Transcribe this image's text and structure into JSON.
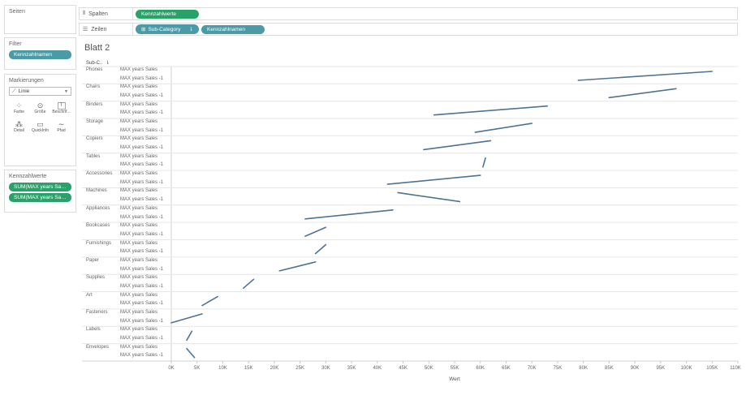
{
  "left_panel": {
    "pages_title": "Seiten",
    "filters_title": "Filter",
    "filter_pills": [
      "Kennzahlnamen"
    ],
    "marks_title": "Markierungen",
    "marks_type": "Linie",
    "marks_buttons": [
      {
        "label": "Farbe",
        "icon": "color-icon"
      },
      {
        "label": "Größe",
        "icon": "size-icon"
      },
      {
        "label": "Beschrif...",
        "icon": "label-icon"
      },
      {
        "label": "Detail",
        "icon": "detail-icon"
      },
      {
        "label": "QuickInfo",
        "icon": "tooltip-icon"
      },
      {
        "label": "Pfad",
        "icon": "path-icon"
      }
    ],
    "measure_values_title": "Kennzahlwerte",
    "measure_value_pills": [
      "SUM(MAX years Sales)",
      "SUM(MAX years Sales..."
    ]
  },
  "shelves": {
    "columns_label": "Spalten",
    "columns_pills": [
      "Kennzahlwerte"
    ],
    "rows_label": "Zeilen",
    "rows_pills": [
      "Sub-Category",
      "Kennzahlnamen"
    ]
  },
  "sheet": {
    "title": "Blatt 2",
    "row_header": "Sub-C..",
    "x_axis_title": "Wert",
    "measure_names": [
      "MAX years Sales",
      "MAX years Sales -1"
    ]
  },
  "colors": {
    "line": "#4e7394",
    "pill_blue": "#4a9aa8",
    "pill_green": "#27a36a",
    "gridline": "#e6e6e6"
  },
  "chart_data": {
    "type": "line",
    "x_axis": {
      "label": "Wert",
      "min": 0,
      "max": 110000,
      "ticks": [
        "0K",
        "5K",
        "10K",
        "15K",
        "20K",
        "25K",
        "30K",
        "35K",
        "40K",
        "45K",
        "50K",
        "55K",
        "60K",
        "65K",
        "70K",
        "75K",
        "80K",
        "85K",
        "90K",
        "95K",
        "100K",
        "105K",
        "110K"
      ]
    },
    "series": [
      {
        "category": "Phones",
        "values": [
          105000,
          79000
        ]
      },
      {
        "category": "Chairs",
        "values": [
          98000,
          85000
        ]
      },
      {
        "category": "Binders",
        "values": [
          73000,
          51000
        ]
      },
      {
        "category": "Storage",
        "values": [
          70000,
          59000
        ]
      },
      {
        "category": "Copiers",
        "values": [
          62000,
          49000
        ]
      },
      {
        "category": "Tables",
        "values": [
          61000,
          60500
        ]
      },
      {
        "category": "Accessories",
        "values": [
          60000,
          42000
        ]
      },
      {
        "category": "Machines",
        "values": [
          44000,
          56000
        ]
      },
      {
        "category": "Appliances",
        "values": [
          43000,
          26000
        ]
      },
      {
        "category": "Bookcases",
        "values": [
          30000,
          26000
        ]
      },
      {
        "category": "Furnishings",
        "values": [
          30000,
          28000
        ]
      },
      {
        "category": "Paper",
        "values": [
          28000,
          21000
        ]
      },
      {
        "category": "Supplies",
        "values": [
          16000,
          14000
        ]
      },
      {
        "category": "Art",
        "values": [
          9000,
          6000
        ]
      },
      {
        "category": "Fasteners",
        "values": [
          6000,
          0
        ]
      },
      {
        "category": "Labels",
        "values": [
          4000,
          3000
        ]
      },
      {
        "category": "Envelopes",
        "values": [
          3000,
          4500
        ]
      }
    ]
  }
}
